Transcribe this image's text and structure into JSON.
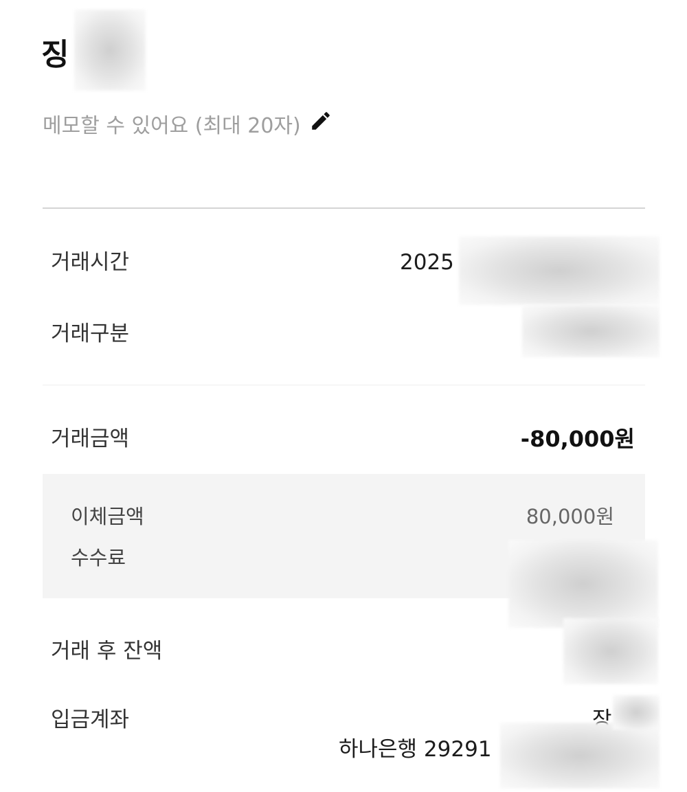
{
  "header": {
    "title": "징",
    "memo_placeholder": "메모할 수 있어요 (최대 20자)",
    "edit_icon": "pencil-icon"
  },
  "details": {
    "time": {
      "label": "거래시간",
      "value": "2025"
    },
    "type": {
      "label": "거래구분",
      "value": ""
    },
    "amount": {
      "label": "거래금액",
      "value": "-80,000원"
    },
    "transfer_amount": {
      "label": "이체금액",
      "value": "80,000원"
    },
    "fee": {
      "label": "수수료",
      "value": ""
    },
    "balance_after": {
      "label": "거래 후 잔액",
      "value": ""
    },
    "deposit_account": {
      "label": "입금계좌",
      "holder": "장",
      "account": "하나은행 29291"
    }
  },
  "colors": {
    "divider": "#d4d4d4",
    "panel_bg": "#f4f4f4",
    "muted_text": "#9e9e9e"
  }
}
